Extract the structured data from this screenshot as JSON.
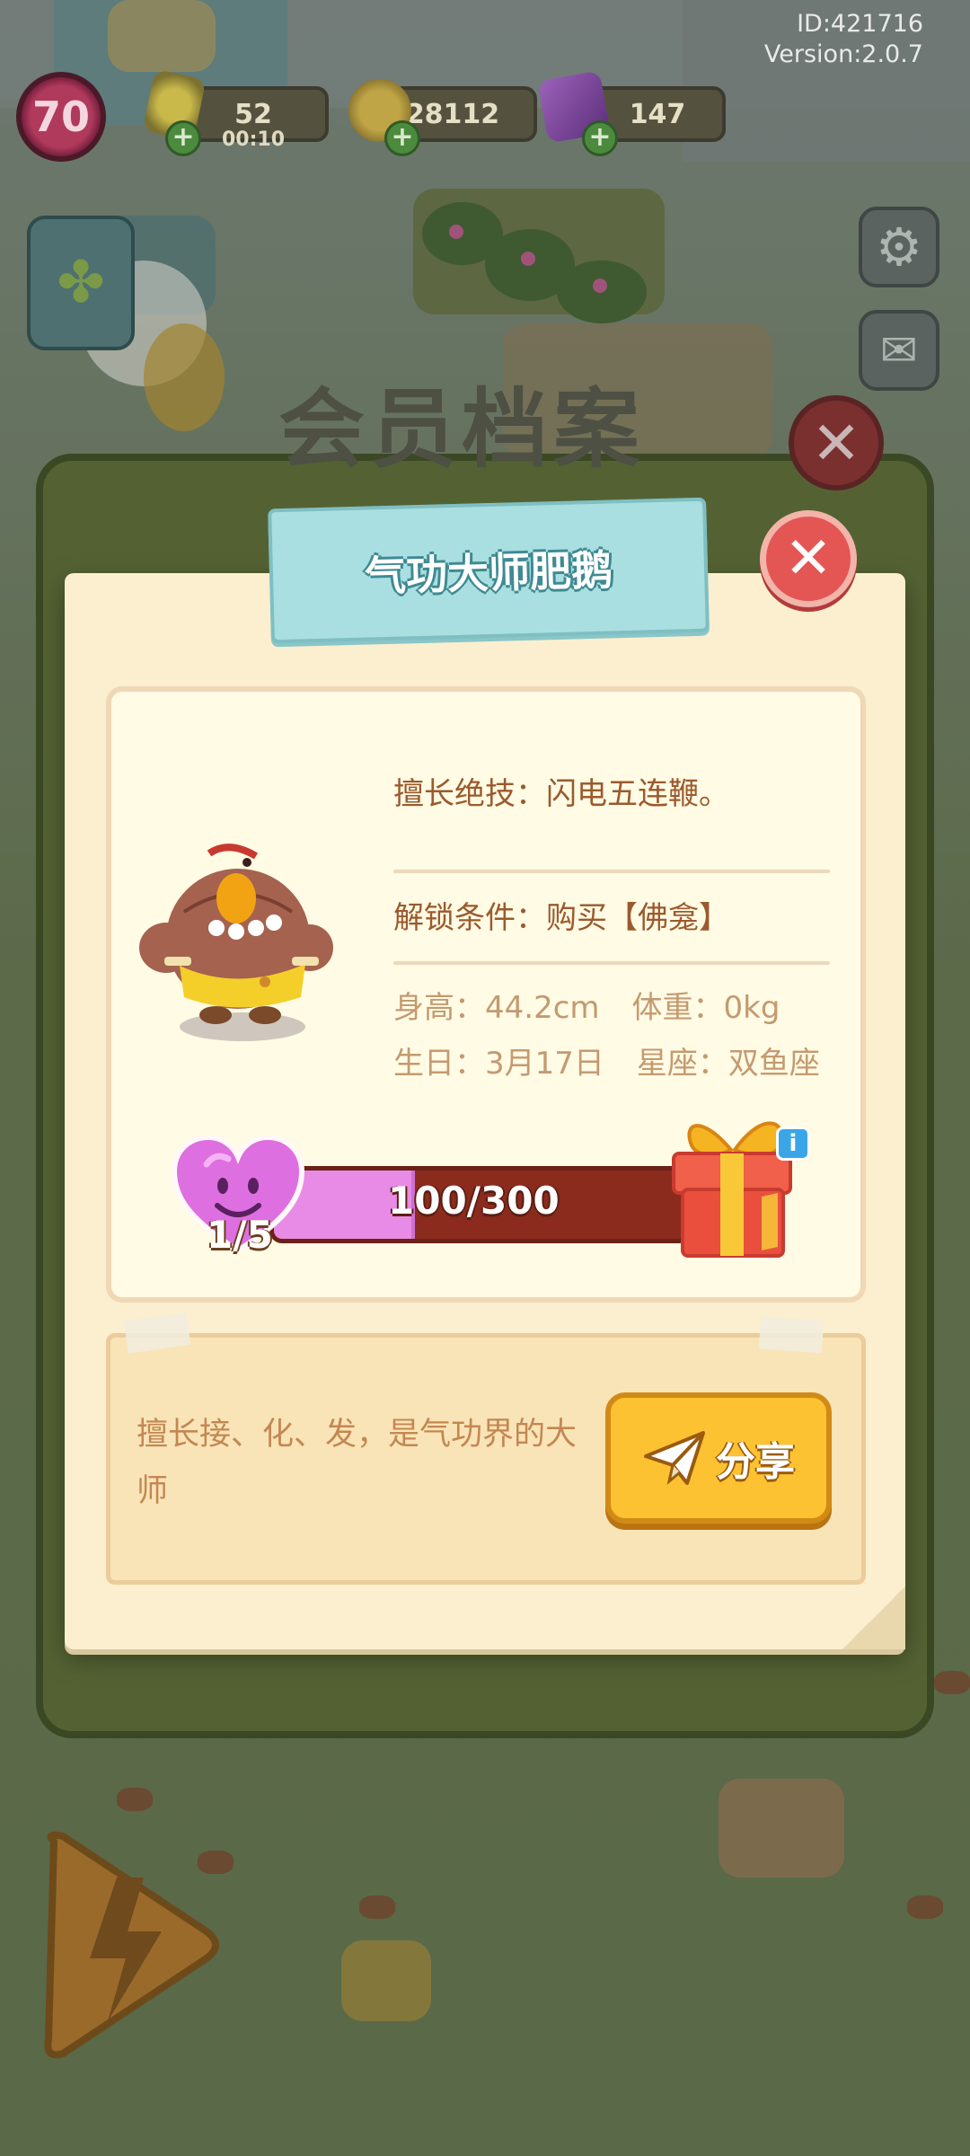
{
  "hud": {
    "id_text": "ID:421716",
    "version_text": "Version:2.0.7",
    "level": "70",
    "energy": "52",
    "energy_timer": "00:10",
    "coins": "28112",
    "gems": "147"
  },
  "background": {
    "panel_title": "会员档案"
  },
  "dialog": {
    "title": "气功大师肥鹅",
    "skill": "擅长绝技：闪电五连鞭。",
    "unlock": "解锁条件：购买【佛龛】",
    "height": "身高：44.2cm",
    "weight": "体重：0kg",
    "birthday": "生日：3月17日",
    "constellation": "星座：双鱼座",
    "progress": {
      "text": "100/300",
      "current": 100,
      "max": 300
    },
    "favor_level": "1/5",
    "description": "擅长接、化、发，是气功界的大师",
    "share_label": "分享"
  },
  "colors": {
    "accent_yellow": "#fcc232",
    "close_red": "#e45654",
    "ribbon_blue": "#a9dfe0",
    "heart_pink": "#e88be6",
    "bar_brown": "#8a2b1d"
  },
  "icons": {
    "close": "close-icon",
    "share": "paper-plane-icon",
    "gift": "gift-box-icon",
    "heart": "smiling-heart-icon",
    "info": "info-icon",
    "settings": "gear-icon",
    "mail": "mail-icon"
  }
}
